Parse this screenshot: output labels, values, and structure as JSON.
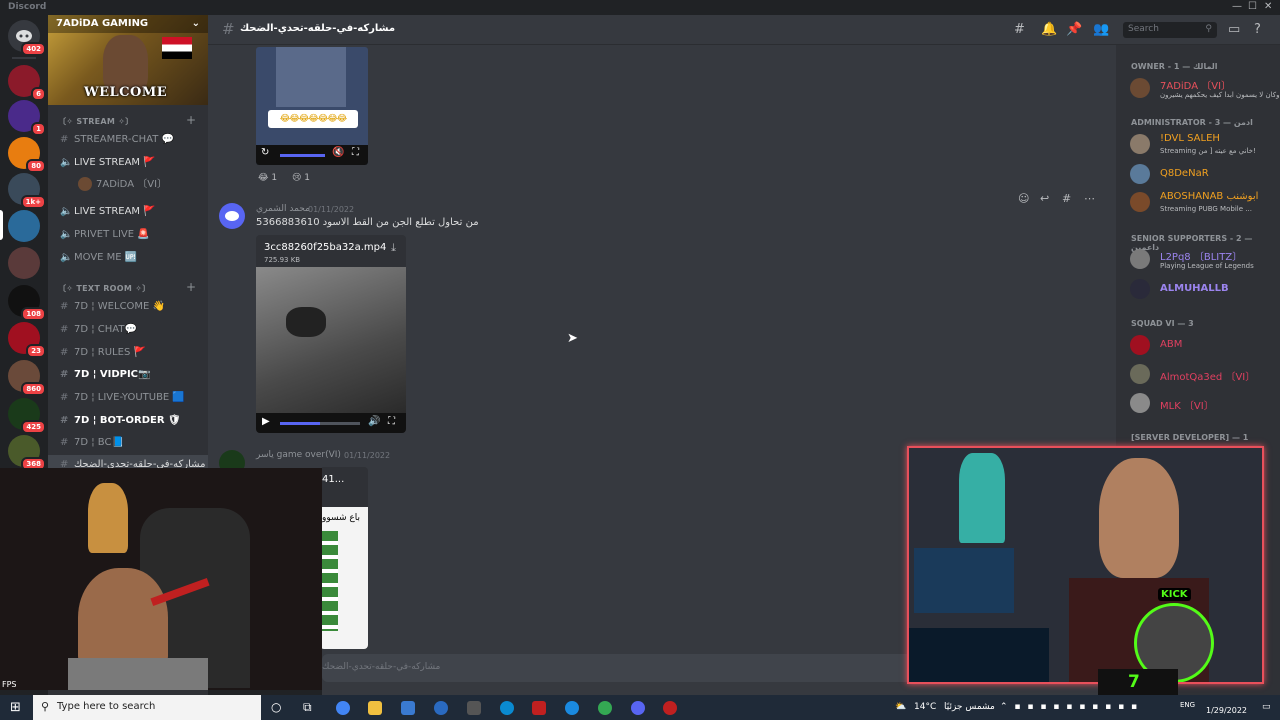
{
  "window": {
    "app_name": "Discord",
    "controls": [
      "—",
      "☐",
      "✕"
    ]
  },
  "guilds": {
    "badges": [
      "402",
      "6",
      "1",
      "80",
      "1k+",
      "108",
      "23",
      "860",
      "425",
      "368"
    ]
  },
  "server": {
    "name": "7ADiDA GAMING",
    "banner_text": "WELCOME",
    "categories": [
      {
        "label": "〔✧ STREAM ✧〕"
      },
      {
        "label": "〔✧ TEXT ROOM ✧〕"
      }
    ],
    "channels": [
      {
        "label": "STREAMER-CHAT 💬",
        "icon": "#"
      },
      {
        "label": "LIVE STREAM 🚩",
        "icon": "🔊"
      },
      {
        "label": "7ADiDA 〔VI〕",
        "icon": "user"
      },
      {
        "label": "LIVE STREAM 🚩",
        "icon": "🔊"
      },
      {
        "label": "PRIVET LIVE 🚨",
        "icon": "🔊"
      },
      {
        "label": "MOVE ME 🆙",
        "icon": "🔊"
      },
      {
        "label": "7D ¦ WELCOME 👋",
        "icon": "#"
      },
      {
        "label": "7D ¦ CHAT💬",
        "icon": "#"
      },
      {
        "label": "7D ¦ RULES 🚩",
        "icon": "#"
      },
      {
        "label": "7D ¦ VIDPIC📷",
        "icon": "#"
      },
      {
        "label": "7D ¦ LIVE-YOUTUBE 🟦",
        "icon": "#"
      },
      {
        "label": "7D ¦ BOT-ORDER 🛡",
        "icon": "#"
      },
      {
        "label": "7D ¦ BC📘",
        "icon": "#"
      },
      {
        "label": "مشاركه-في-حلقه-تحدي-الضحك",
        "icon": "#"
      }
    ]
  },
  "header": {
    "channel_name": "مشاركه-في-حلقه-تحدي-الضحك",
    "search_placeholder": "Search"
  },
  "messages": {
    "reactions": [
      {
        "emoji": "😂",
        "count": "1"
      },
      {
        "emoji": "😢",
        "count": "1"
      }
    ],
    "msg1": {
      "author": "محمد الشمري",
      "timestamp": "01/11/2022",
      "text": "من تحاول تطلع الجن من القط الاسود 5366883610",
      "file_name": "3cc88260f25ba32a.mp4",
      "file_size": "725.93 KB"
    },
    "msg2": {
      "author": "ياسر game over(VI)",
      "timestamp": "01/11/2022",
      "file_name": "41...",
      "overlay_text": "باع شسوو"
    }
  },
  "message_input": {
    "placeholder": "مشاركه-في-حلقه-تحدي-الضحك"
  },
  "members": {
    "groups": [
      {
        "label": "OWNER - 1 — المالك",
        "members": [
          {
            "name": "7ADiDA 〔VI〕",
            "status": "وكان لا يسمون ابدا كيف يحكمهم يشيرون",
            "color": "#e8505b"
          }
        ]
      },
      {
        "label": "ADMINISTRATOR - 3 — ادمن",
        "members": [
          {
            "name": "!DVL SALEH",
            "status": "Streaming خاني مع عيته [ من!",
            "color": "#f0a020"
          },
          {
            "name": "Q8DeNaR",
            "status": "",
            "color": "#f0a020"
          },
          {
            "name": "ABOSHANAB ابوشنب",
            "status": "Streaming PUBG Mobile ...",
            "color": "#f0a020"
          }
        ]
      },
      {
        "label": "SENIOR SUPPORTERS - 2 — داعمين",
        "members": [
          {
            "name": "L2Pq8 〔BLITZ〕",
            "status": "Playing League of Legends",
            "color": "#9b84ee"
          },
          {
            "name": "ALMUHALLB",
            "status": "",
            "color": "#9b84ee"
          }
        ]
      },
      {
        "label": "SQUAD VI — 3",
        "members": [
          {
            "name": "ABM",
            "status": "",
            "color": "#e04060"
          },
          {
            "name": "AlmotQa3ed 〔VI〕",
            "status": "",
            "color": "#e04060"
          },
          {
            "name": "MLK 〔VI〕",
            "status": "",
            "color": "#e04060"
          }
        ]
      },
      {
        "label": "[SERVER DEVELOPER] — 1",
        "members": []
      }
    ]
  },
  "overlay": {
    "kick_label": "KICK",
    "big_number": "7"
  },
  "taskbar": {
    "search_placeholder": "Type here to search",
    "weather": "14°C",
    "weather_desc": "مشمس جزئيًا",
    "lang": "ENG",
    "date": "1/29/2022",
    "left_label": "FPS"
  },
  "colors": {
    "accent": "#5865f2",
    "notification": "#ed4245",
    "webcam_border": "#e8505b"
  }
}
